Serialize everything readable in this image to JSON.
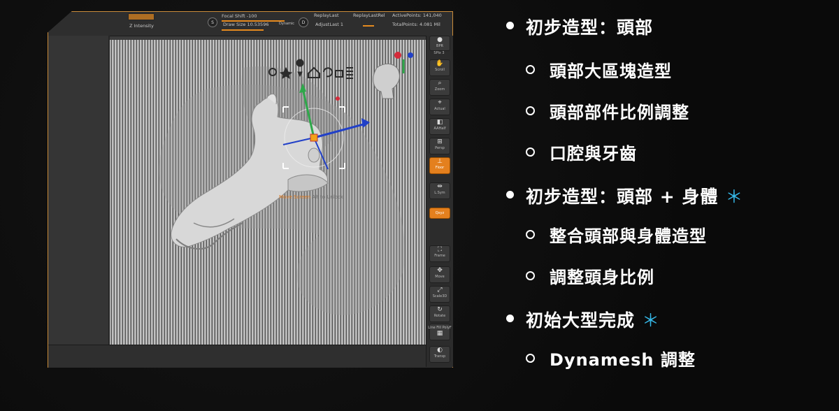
{
  "zbrush": {
    "topbar": {
      "intensity": "Z Intensity",
      "focal_shift": "Focal Shift -100",
      "draw_size": "Draw Size 10.53596",
      "dynamic": "Dynamic",
      "replay_last": "ReplayLast",
      "replay_last_rel": "ReplayLastRel",
      "adjust_last": "AdjustLast 1",
      "active_points": "ActivePoints: 141,040",
      "total_points": "TotalPoints: 4.081 Mil",
      "s_icon": "S",
      "d_icon": "D"
    },
    "viewport_hint": {
      "orange": "Move Screen",
      "gray": "Alt to Unlock"
    },
    "right_shelf": [
      {
        "label": "BPR",
        "icon": "render-sphere-icon",
        "glyph": "●"
      },
      {
        "label": "SPix 3",
        "icon": "spix-slider",
        "glyph": ""
      },
      {
        "label": "Scroll",
        "icon": "hand-icon",
        "glyph": "✋"
      },
      {
        "label": "Zoom",
        "icon": "zoom-icon",
        "glyph": "⌕"
      },
      {
        "label": "Actual",
        "icon": "actual-icon",
        "glyph": "⌖"
      },
      {
        "label": "AAHalf",
        "icon": "aahalf-icon",
        "glyph": "◧"
      },
      {
        "label": "Persp",
        "icon": "persp-icon",
        "glyph": "⊞"
      },
      {
        "label": "Floor",
        "icon": "floor-icon",
        "glyph": "⊥"
      },
      {
        "label": "L.Sym",
        "icon": "lsym-icon",
        "glyph": "⇹"
      },
      {
        "label": "Qxyz",
        "icon": "xyz-icon",
        "glyph": "⟲"
      },
      {
        "label": "Frame",
        "icon": "frame-icon",
        "glyph": "⛶"
      },
      {
        "label": "Move",
        "icon": "move-icon",
        "glyph": "✥"
      },
      {
        "label": "Scale3D",
        "icon": "scale-icon",
        "glyph": "⤢"
      },
      {
        "label": "Rotate",
        "icon": "rotate-icon",
        "glyph": "↻"
      },
      {
        "label": "Line Fill PolyF",
        "icon": "polyframe-icon",
        "glyph": "▦"
      },
      {
        "label": "Transp",
        "icon": "transp-icon",
        "glyph": "◐"
      }
    ],
    "gizmo_icons": [
      "gear-icon",
      "pin-icon",
      "location-icon",
      "home-icon",
      "undo-icon",
      "lock-icon",
      "list-icon"
    ]
  },
  "slide": {
    "items": [
      {
        "level": 1,
        "text": "初步造型：頭部",
        "star": ""
      },
      {
        "level": 2,
        "text": "頭部大區塊造型"
      },
      {
        "level": 2,
        "text": "頭部部件比例調整"
      },
      {
        "level": 2,
        "text": "口腔與牙齒"
      },
      {
        "level": 1,
        "text": "初步造型：頭部 + 身體",
        "star": "＊"
      },
      {
        "level": 2,
        "text": "整合頭部與身體造型"
      },
      {
        "level": 2,
        "text": "調整頭身比例"
      },
      {
        "level": 1,
        "text": "初始大型完成",
        "star": "＊"
      },
      {
        "level": 2,
        "text": "Dynamesh 調整"
      }
    ],
    "colors": {
      "star": "#35b8e8",
      "accent": "#e4801e"
    }
  }
}
